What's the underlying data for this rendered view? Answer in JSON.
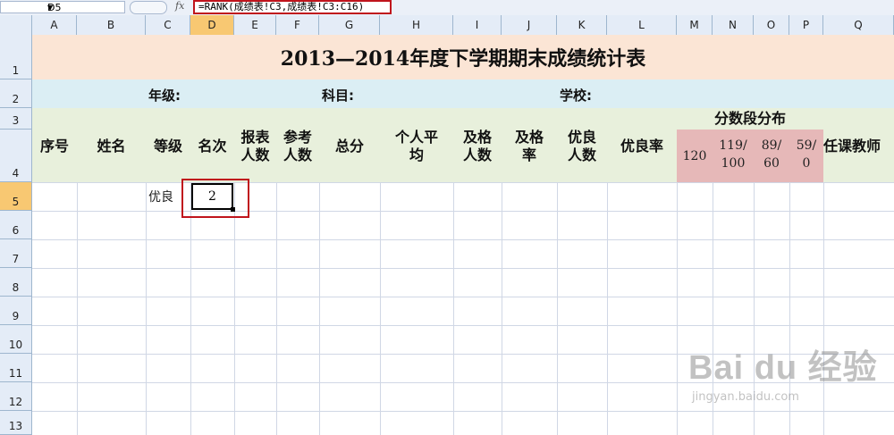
{
  "formula_bar": {
    "name_box": "D5",
    "fx_label": "fx",
    "formula": "=RANK(成绩表!C3,成绩表!C3:C16)"
  },
  "columns": [
    "A",
    "B",
    "C",
    "D",
    "E",
    "F",
    "G",
    "H",
    "I",
    "J",
    "K",
    "L",
    "M",
    "N",
    "O",
    "P",
    "Q"
  ],
  "rows": [
    "1",
    "2",
    "3",
    "4",
    "5",
    "6",
    "7",
    "8",
    "9",
    "10",
    "11",
    "12",
    "13"
  ],
  "sheet": {
    "title": "2013—2014年度下学期期末成绩统计表",
    "info": {
      "grade": "年级:",
      "subject": "科目:",
      "school": "学校:"
    },
    "headers": {
      "seq": "序号",
      "name": "姓名",
      "level": "等级",
      "rank": "名次",
      "enrolled": [
        "报表",
        "人数"
      ],
      "tested": [
        "参考",
        "人数"
      ],
      "total": "总分",
      "avg": [
        "个人平",
        "均"
      ],
      "pass_count": [
        "及格",
        "人数"
      ],
      "pass_rate": [
        "及格",
        "率"
      ],
      "excel_count": [
        "优良",
        "人数"
      ],
      "excel_rate": "优良率",
      "dist": "分数段分布",
      "teacher": "任课教师"
    },
    "dist_bins": [
      [
        "120"
      ],
      [
        "119/",
        "100"
      ],
      [
        "89/",
        "60"
      ],
      [
        "59/",
        "0"
      ]
    ],
    "row5": {
      "level": "优良",
      "rank": "2"
    }
  },
  "watermark": {
    "logo": "Bai du 经验",
    "site": "jingyan.baidu.com"
  },
  "colors": {
    "selection": "#f8c872",
    "highlight_red": "#c0141c",
    "title_bg": "#fbe5d5"
  }
}
